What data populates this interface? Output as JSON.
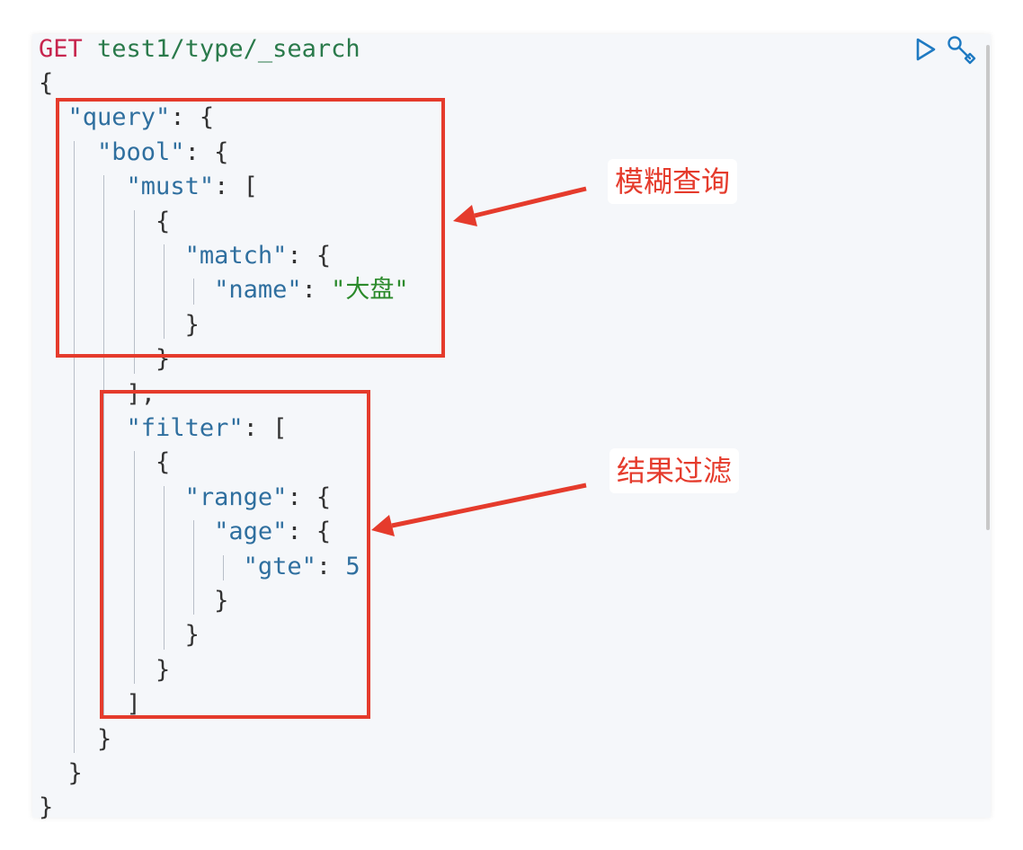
{
  "request": {
    "method": "GET",
    "url": "test1/type/_search"
  },
  "code_lines": [
    [
      {
        "t": "{",
        "c": "p"
      }
    ],
    [
      {
        "t": "\"query\"",
        "c": "k"
      },
      {
        "t": ": {",
        "c": "p"
      }
    ],
    [
      {
        "t": "\"bool\"",
        "c": "k"
      },
      {
        "t": ": {",
        "c": "p"
      }
    ],
    [
      {
        "t": "\"must\"",
        "c": "k"
      },
      {
        "t": ": [",
        "c": "p"
      }
    ],
    [
      {
        "t": "{",
        "c": "p"
      }
    ],
    [
      {
        "t": "\"match\"",
        "c": "k"
      },
      {
        "t": ": {",
        "c": "p"
      }
    ],
    [
      {
        "t": "\"name\"",
        "c": "k"
      },
      {
        "t": ": ",
        "c": "p"
      },
      {
        "t": "\"大盘\"",
        "c": "s"
      }
    ],
    [
      {
        "t": "}",
        "c": "p"
      }
    ],
    [
      {
        "t": "}",
        "c": "p"
      }
    ],
    [
      {
        "t": "],",
        "c": "p"
      }
    ],
    [
      {
        "t": "\"filter\"",
        "c": "k"
      },
      {
        "t": ": [",
        "c": "p"
      }
    ],
    [
      {
        "t": "{",
        "c": "p"
      }
    ],
    [
      {
        "t": "\"range\"",
        "c": "k"
      },
      {
        "t": ": {",
        "c": "p"
      }
    ],
    [
      {
        "t": "\"age\"",
        "c": "k"
      },
      {
        "t": ": {",
        "c": "p"
      }
    ],
    [
      {
        "t": "\"gte\"",
        "c": "k"
      },
      {
        "t": ": ",
        "c": "p"
      },
      {
        "t": "5",
        "c": "n"
      }
    ],
    [
      {
        "t": "}",
        "c": "p"
      }
    ],
    [
      {
        "t": "}",
        "c": "p"
      }
    ],
    [
      {
        "t": "}",
        "c": "p"
      }
    ],
    [
      {
        "t": "]",
        "c": "p"
      }
    ],
    [
      {
        "t": "}",
        "c": "p"
      }
    ],
    [
      {
        "t": "}",
        "c": "p"
      }
    ],
    [
      {
        "t": "}",
        "c": "p"
      }
    ]
  ],
  "code_indent": [
    0,
    1,
    2,
    3,
    4,
    5,
    6,
    5,
    4,
    3,
    3,
    4,
    5,
    6,
    7,
    6,
    5,
    4,
    3,
    2,
    1,
    0
  ],
  "toolbar": {
    "run_icon": "play-icon",
    "settings_icon": "wrench-icon"
  },
  "annotations": {
    "fuzzy_query": "模糊查询",
    "result_filter": "结果过滤"
  },
  "colors": {
    "method": "#c7254e",
    "url": "#2a7a4b",
    "key": "#2f6f9f",
    "string": "#2b8a2b",
    "number": "#2f6f9f",
    "punct": "#333333",
    "annotation": "#e53b2c",
    "editor_bg": "#f5f7fa"
  }
}
